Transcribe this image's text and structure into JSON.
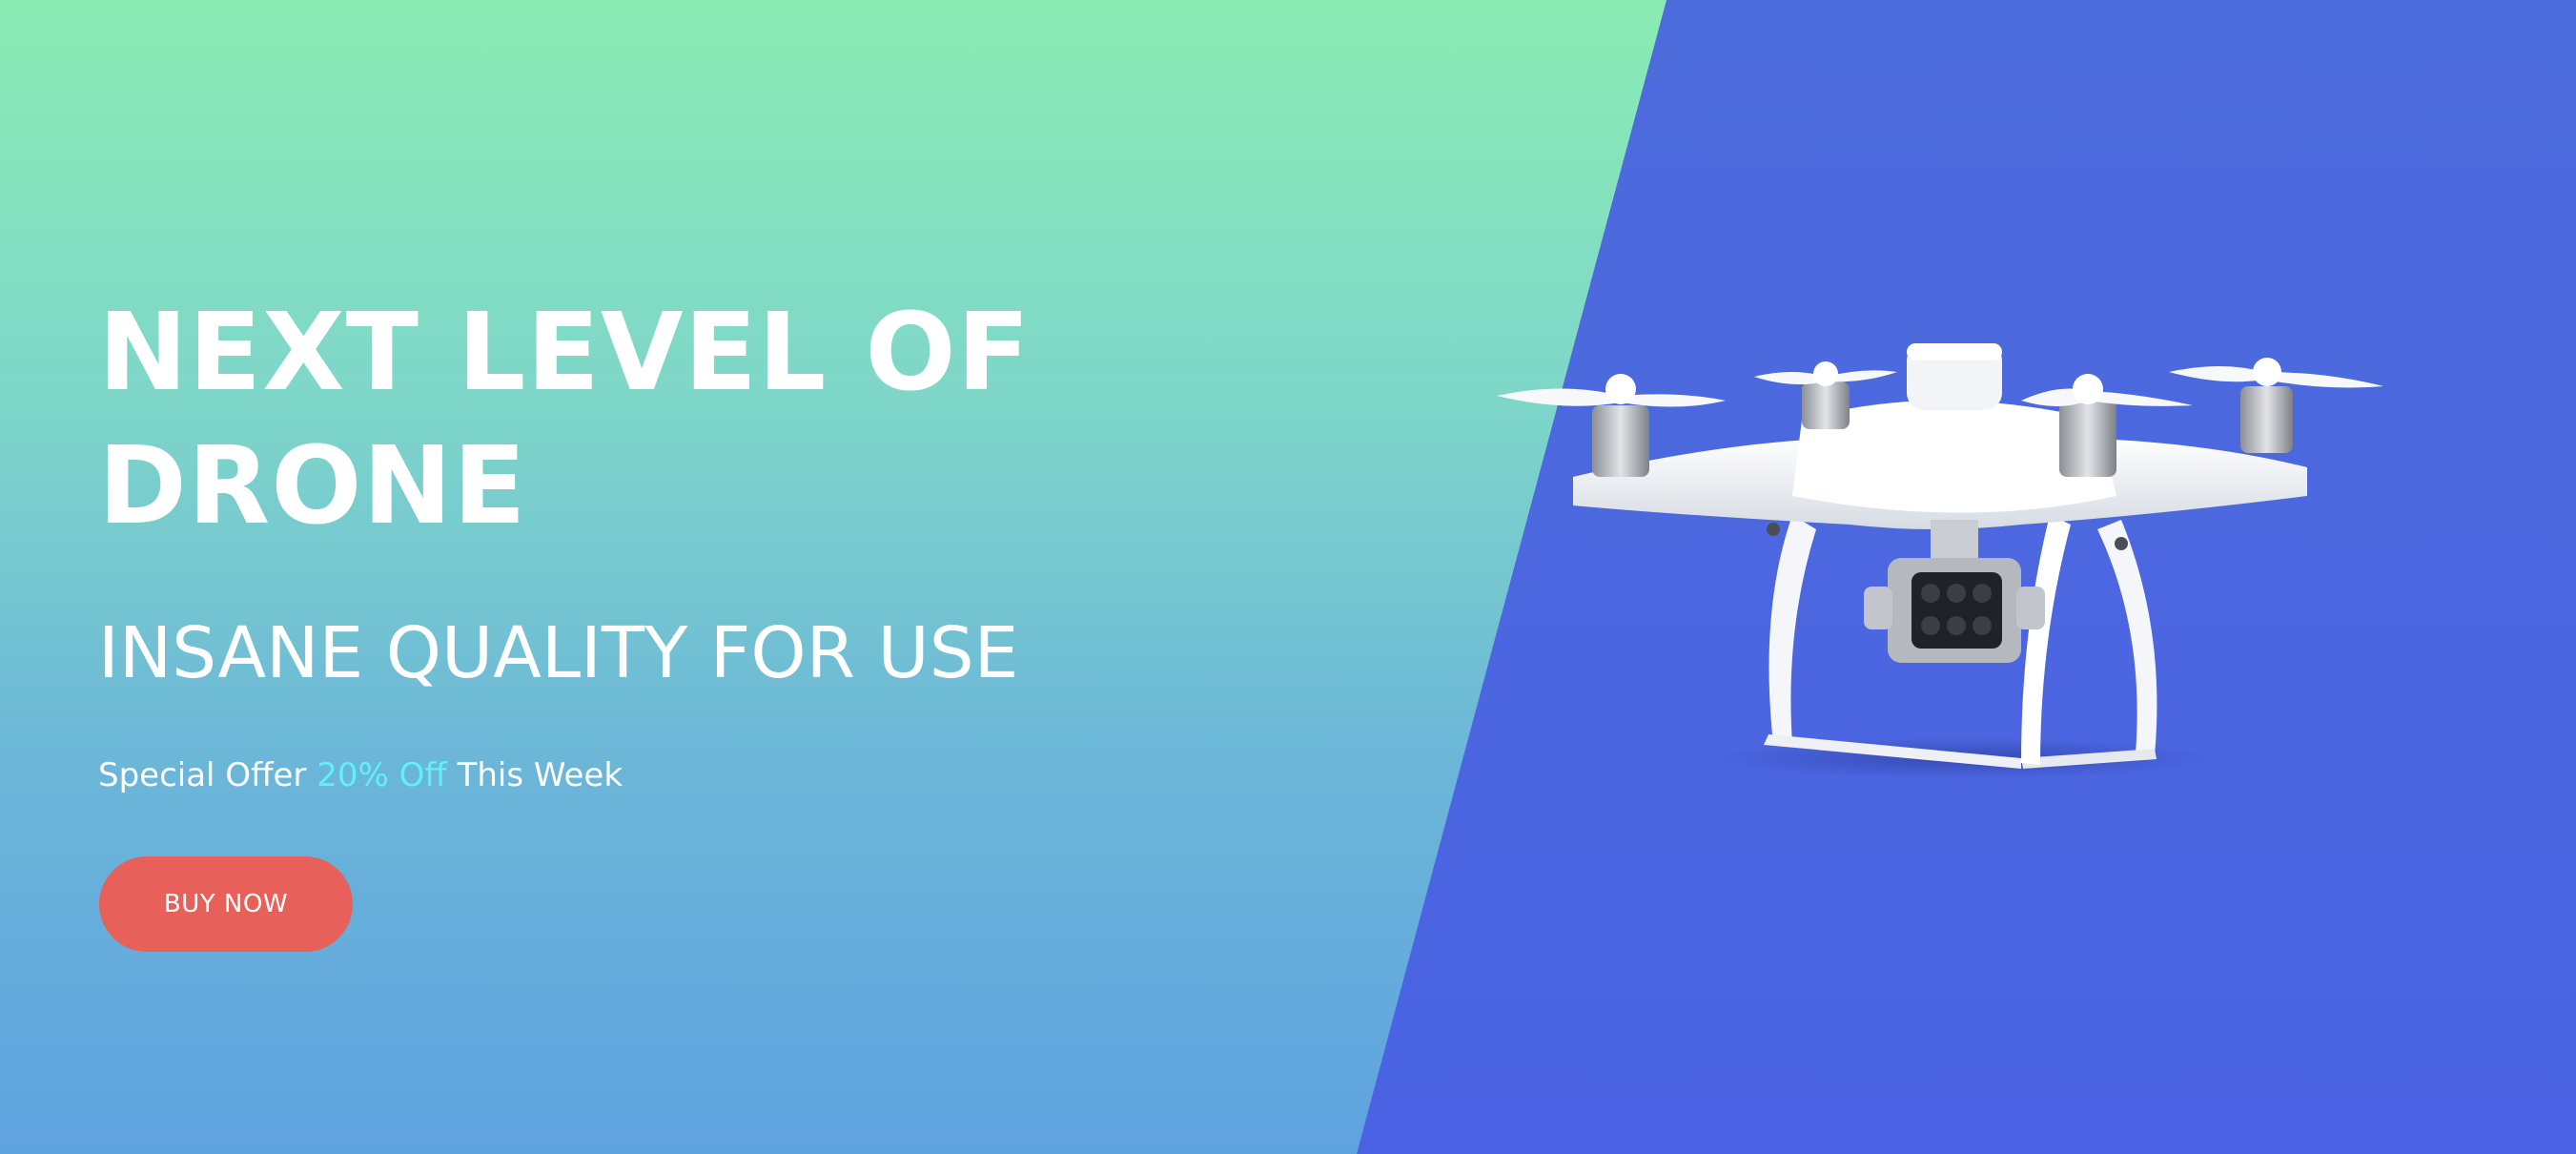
{
  "hero": {
    "title_line1": "NEXT LEVEL OF",
    "title_line2": "DRONE",
    "subtitle": "INSANE QUALITY FOR USE",
    "offer_prefix": "Special Offer ",
    "offer_highlight": "20% Off",
    "offer_suffix": " This Week",
    "button_label": "BUY NOW"
  },
  "colors": {
    "gradient_top": "#8aecb4",
    "gradient_bottom": "#5fa2e0",
    "panel_blue": "#4a62e3",
    "button": "#e8605a",
    "offer_accent": "#5ff0f8"
  },
  "icons": {
    "product_image": "drone-image"
  }
}
